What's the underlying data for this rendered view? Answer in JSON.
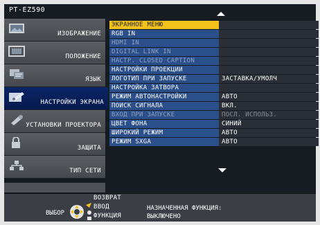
{
  "model": "PT-EZ590",
  "sidebar": {
    "items": [
      {
        "label": "ИЗОБРАЖЕНИЕ",
        "icon": "picture-icon"
      },
      {
        "label": "ПОЛОЖЕНИЕ",
        "icon": "position-icon"
      },
      {
        "label": "ЯЗЫК",
        "icon": "language-icon"
      },
      {
        "label": "НАСТРОЙКИ ЭКРАНА",
        "icon": "display-settings-icon",
        "active": true
      },
      {
        "label": "УСТАНОВКИ ПРОЕКТОРА",
        "icon": "projector-settings-icon"
      },
      {
        "label": "ЗАЩИТА",
        "icon": "lock-icon"
      },
      {
        "label": "ТИП СЕТИ",
        "icon": "network-icon"
      }
    ]
  },
  "menu": {
    "rows": [
      {
        "label": "ЭКРАННОЕ МЕНЮ",
        "value": "",
        "state": "selected"
      },
      {
        "label": "RGB IN",
        "value": "",
        "state": "enabled"
      },
      {
        "label": "HDMI IN",
        "value": "",
        "state": "disabled"
      },
      {
        "label": "DIGITAL LINK IN",
        "value": "",
        "state": "disabled"
      },
      {
        "label": "НАСТР. CLOSED CAPTION",
        "value": "",
        "state": "disabled"
      },
      {
        "label": "НАСТРОЙКИ ПРОЕКЦИИ",
        "value": "",
        "state": "enabled"
      },
      {
        "label": "ЛОГОТИП ПРИ ЗАПУСКЕ",
        "value": "ЗАСТАВКА/УМОЛЧ",
        "state": "enabled"
      },
      {
        "label": "НАСТРОЙКА ЗАТВОРА",
        "value": "",
        "state": "enabled"
      },
      {
        "label": "РЕЖИМ АВТОНАСТРОЙКИ",
        "value": "АВТО",
        "state": "enabled"
      },
      {
        "label": "ПОИСК СИГНАЛА",
        "value": "ВКЛ.",
        "state": "enabled"
      },
      {
        "label": "ВХОД ПРИ ЗАПУСКЕ",
        "value": "ПОСЛ. ИСПОЛЬЗ.",
        "state": "disabled"
      },
      {
        "label": "ЦВЕТ ФОНА",
        "value": "СИНИЙ",
        "state": "enabled"
      },
      {
        "label": "ШИРОКИЙ РЕЖИМ",
        "value": "АВТО",
        "state": "enabled"
      },
      {
        "label": "РЕЖИМ SXGA",
        "value": "АВТО",
        "state": "enabled"
      }
    ]
  },
  "footer": {
    "select_label": "ВЫБОР",
    "back_label": "ВОЗВРАТ",
    "enter_label": "ВВОД",
    "function_label": "ФУНКЦИЯ",
    "assigned_function_label": "НАЗНАЧЕННАЯ ФУНКЦИЯ:",
    "assigned_function_value": "ВЫКЛЮЧЕНО"
  },
  "colors": {
    "selected_row": "#f3c21a",
    "row_blue": "#2a4f8a",
    "active_side": "#0b2466"
  }
}
